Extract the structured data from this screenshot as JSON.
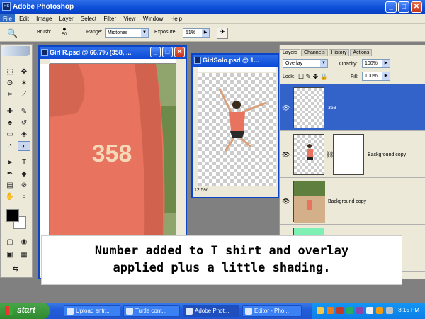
{
  "app": {
    "title": "Adobe Photoshop"
  },
  "window_controls": {
    "minimize": "_",
    "maximize": "□",
    "close": "✕"
  },
  "menu": [
    "File",
    "Edit",
    "Image",
    "Layer",
    "Select",
    "Filter",
    "View",
    "Window",
    "Help"
  ],
  "options": {
    "brush_label": "Brush:",
    "brush_size": "50",
    "range_label": "Range:",
    "range_value": "Midtones",
    "exposure_label": "Exposure:",
    "exposure_value": "51%"
  },
  "doc1": {
    "title": "Girl R.psd @ 66.7% (358, ..."
  },
  "doc1_image": {
    "shirt_color": "#e8735e",
    "number_text": "358"
  },
  "doc2": {
    "title": "GirlSolo.psd @ 1...",
    "zoom": "12.5%"
  },
  "layers_panel": {
    "tabs": [
      "Layers",
      "Channels",
      "History",
      "Actions"
    ],
    "blend_mode": "Overlay",
    "opacity_label": "Opacity:",
    "opacity_value": "100%",
    "lock_label": "Lock:",
    "fill_label": "Fill:",
    "fill_value": "100%",
    "layers": [
      {
        "name": "358",
        "selected": true
      },
      {
        "name": "Background copy",
        "selected": false
      },
      {
        "name": "Background copy",
        "selected": false
      }
    ]
  },
  "caption": {
    "line1": "Number added to T shirt and overlay",
    "line2": "applied plus a little shading."
  },
  "taskbar": {
    "start": "start",
    "tasks": [
      "Upload entr...",
      "Turtle cont...",
      "Adobe Phot...",
      "Editor - Pho..."
    ],
    "clock": "8:15 PM"
  }
}
